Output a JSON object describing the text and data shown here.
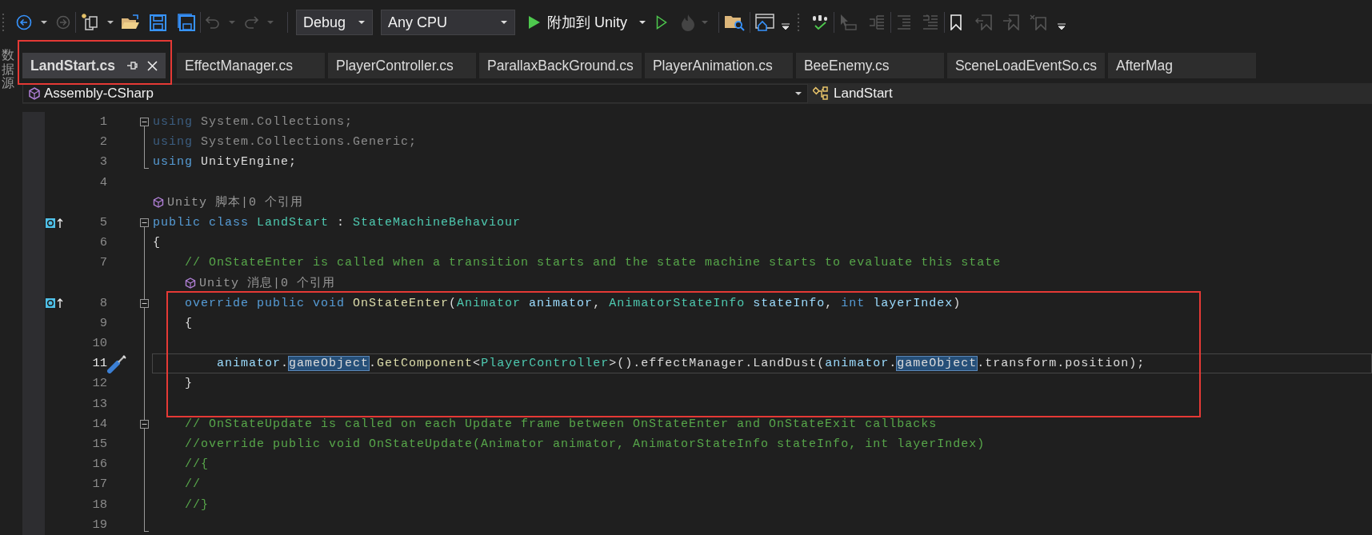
{
  "toolbar": {
    "configuration": {
      "value": "Debug"
    },
    "platform": {
      "value": "Any CPU"
    },
    "start_button": {
      "label": "附加到 Unity"
    }
  },
  "side_tab": {
    "label": "数据源"
  },
  "tabs": [
    {
      "label": "LandStart.cs",
      "selected": true,
      "framed": true
    },
    {
      "label": "EffectManager.cs",
      "selected": false,
      "framed": false
    },
    {
      "label": "PlayerController.cs",
      "selected": false,
      "framed": false
    },
    {
      "label": "ParallaxBackGround.cs",
      "selected": false,
      "framed": false
    },
    {
      "label": "PlayerAnimation.cs",
      "selected": false,
      "framed": false
    },
    {
      "label": "BeeEnemy.cs",
      "selected": false,
      "framed": false
    },
    {
      "label": "SceneLoadEventSo.cs",
      "selected": false,
      "framed": false
    },
    {
      "label": "AfterMag",
      "selected": false,
      "framed": false
    }
  ],
  "navigation_bar": {
    "project": "Assembly-CSharp",
    "type": "LandStart"
  },
  "editor": {
    "lines": [
      {
        "kind": "code",
        "number": "1",
        "collapsible": true,
        "in_block": false,
        "override_marker": false,
        "quick_actions": false,
        "current": false,
        "framed": false,
        "tokens": [
          {
            "kind": "dim-keyword",
            "text": "using"
          },
          {
            "kind": "dim",
            "text": " System.Collections;"
          }
        ]
      },
      {
        "kind": "code",
        "number": "2",
        "collapsible": false,
        "in_block": true,
        "override_marker": false,
        "quick_actions": false,
        "current": false,
        "framed": false,
        "tokens": [
          {
            "kind": "dim-keyword",
            "text": "using"
          },
          {
            "kind": "dim",
            "text": " System.Collections.Generic;"
          }
        ]
      },
      {
        "kind": "code",
        "number": "3",
        "collapsible": false,
        "in_block": true,
        "override_marker": false,
        "quick_actions": false,
        "current": false,
        "framed": false,
        "tokens": [
          {
            "kind": "keyword",
            "text": "using"
          },
          {
            "kind": "plain",
            "text": " UnityEngine;"
          }
        ]
      },
      {
        "kind": "code",
        "number": "4",
        "collapsible": false,
        "in_block": false,
        "override_marker": false,
        "quick_actions": false,
        "current": false,
        "framed": false
      },
      {
        "kind": "codelens",
        "text": "Unity 脚本|0 个引用"
      },
      {
        "kind": "code",
        "number": "5",
        "collapsible": true,
        "in_block": false,
        "override_marker": true,
        "quick_actions": false,
        "current": false,
        "framed": false,
        "tokens": [
          {
            "kind": "keyword",
            "text": "public class"
          },
          {
            "kind": "type",
            "text": " LandStart"
          },
          {
            "kind": "plain",
            "text": " : "
          },
          {
            "kind": "type",
            "text": "StateMachineBehaviour"
          }
        ]
      },
      {
        "kind": "code",
        "number": "6",
        "collapsible": false,
        "in_block": true,
        "override_marker": false,
        "quick_actions": false,
        "current": false,
        "framed": false,
        "tokens": [
          {
            "kind": "plain",
            "text": "{"
          }
        ]
      },
      {
        "kind": "code",
        "number": "7",
        "collapsible": false,
        "in_block": true,
        "override_marker": false,
        "quick_actions": false,
        "current": false,
        "framed": false,
        "tokens": [
          {
            "kind": "comment",
            "text": "    // OnStateEnter is called when a transition starts and the state machine starts to evaluate this state"
          }
        ]
      },
      {
        "kind": "codelens",
        "text": "Unity 消息|0 个引用"
      },
      {
        "kind": "code",
        "number": "8",
        "collapsible": true,
        "in_block": true,
        "override_marker": true,
        "quick_actions": false,
        "current": false,
        "framed": true,
        "tokens": [
          {
            "kind": "keyword",
            "text": "    override public void"
          },
          {
            "kind": "method",
            "text": " OnStateEnter"
          },
          {
            "kind": "plain",
            "text": "("
          },
          {
            "kind": "type",
            "text": "Animator"
          },
          {
            "kind": "param",
            "text": " animator"
          },
          {
            "kind": "plain",
            "text": ", "
          },
          {
            "kind": "type",
            "text": "AnimatorStateInfo"
          },
          {
            "kind": "param",
            "text": " stateInfo"
          },
          {
            "kind": "plain",
            "text": ", "
          },
          {
            "kind": "keyword",
            "text": "int"
          },
          {
            "kind": "param",
            "text": " layerIndex"
          },
          {
            "kind": "plain",
            "text": ")"
          }
        ]
      },
      {
        "kind": "code",
        "number": "9",
        "collapsible": false,
        "in_block": true,
        "override_marker": false,
        "quick_actions": false,
        "current": false,
        "framed": true,
        "tokens": [
          {
            "kind": "plain",
            "text": "    {"
          }
        ]
      },
      {
        "kind": "code",
        "number": "10",
        "collapsible": false,
        "in_block": true,
        "override_marker": false,
        "quick_actions": false,
        "current": false,
        "framed": true
      },
      {
        "kind": "code",
        "number": "11",
        "collapsible": false,
        "in_block": true,
        "override_marker": false,
        "quick_actions": true,
        "current": true,
        "framed": true,
        "tokens": [
          {
            "kind": "param",
            "text": "        animator"
          },
          {
            "kind": "plain",
            "text": "."
          },
          {
            "kind": "reference",
            "text": "gameObject"
          },
          {
            "kind": "plain",
            "text": "."
          },
          {
            "kind": "method",
            "text": "GetComponent"
          },
          {
            "kind": "plain",
            "text": "<"
          },
          {
            "kind": "type",
            "text": "PlayerController"
          },
          {
            "kind": "plain",
            "text": ">().effectManager.LandDust("
          },
          {
            "kind": "param",
            "text": "animator"
          },
          {
            "kind": "plain",
            "text": "."
          },
          {
            "kind": "reference",
            "text": "gameObject"
          },
          {
            "kind": "plain",
            "text": ".transform.position);"
          }
        ]
      },
      {
        "kind": "code",
        "number": "12",
        "collapsible": false,
        "in_block": true,
        "override_marker": false,
        "quick_actions": false,
        "current": false,
        "framed": true,
        "tokens": [
          {
            "kind": "plain",
            "text": "    }"
          }
        ]
      },
      {
        "kind": "code",
        "number": "13",
        "collapsible": false,
        "in_block": true,
        "override_marker": false,
        "quick_actions": false,
        "current": false,
        "framed": true
      },
      {
        "kind": "code",
        "number": "14",
        "collapsible": true,
        "in_block": true,
        "override_marker": false,
        "quick_actions": false,
        "current": false,
        "framed": false,
        "tokens": [
          {
            "kind": "comment",
            "text": "    // OnStateUpdate is called on each Update frame between OnStateEnter and OnStateExit callbacks"
          }
        ]
      },
      {
        "kind": "code",
        "number": "15",
        "collapsible": false,
        "in_block": true,
        "override_marker": false,
        "quick_actions": false,
        "current": false,
        "framed": false,
        "tokens": [
          {
            "kind": "comment",
            "text": "    //override public void OnStateUpdate(Animator animator, AnimatorStateInfo stateInfo, int layerIndex)"
          }
        ]
      },
      {
        "kind": "code",
        "number": "16",
        "collapsible": false,
        "in_block": true,
        "override_marker": false,
        "quick_actions": false,
        "current": false,
        "framed": false,
        "tokens": [
          {
            "kind": "comment",
            "text": "    //{"
          }
        ]
      },
      {
        "kind": "code",
        "number": "17",
        "collapsible": false,
        "in_block": true,
        "override_marker": false,
        "quick_actions": false,
        "current": false,
        "framed": false,
        "tokens": [
          {
            "kind": "comment",
            "text": "    //"
          }
        ]
      },
      {
        "kind": "code",
        "number": "18",
        "collapsible": false,
        "in_block": true,
        "override_marker": false,
        "quick_actions": false,
        "current": false,
        "framed": false,
        "tokens": [
          {
            "kind": "comment",
            "text": "    //}"
          }
        ]
      },
      {
        "kind": "code",
        "number": "19",
        "collapsible": false,
        "in_block": true,
        "override_marker": false,
        "quick_actions": false,
        "current": false,
        "framed": false
      }
    ]
  }
}
